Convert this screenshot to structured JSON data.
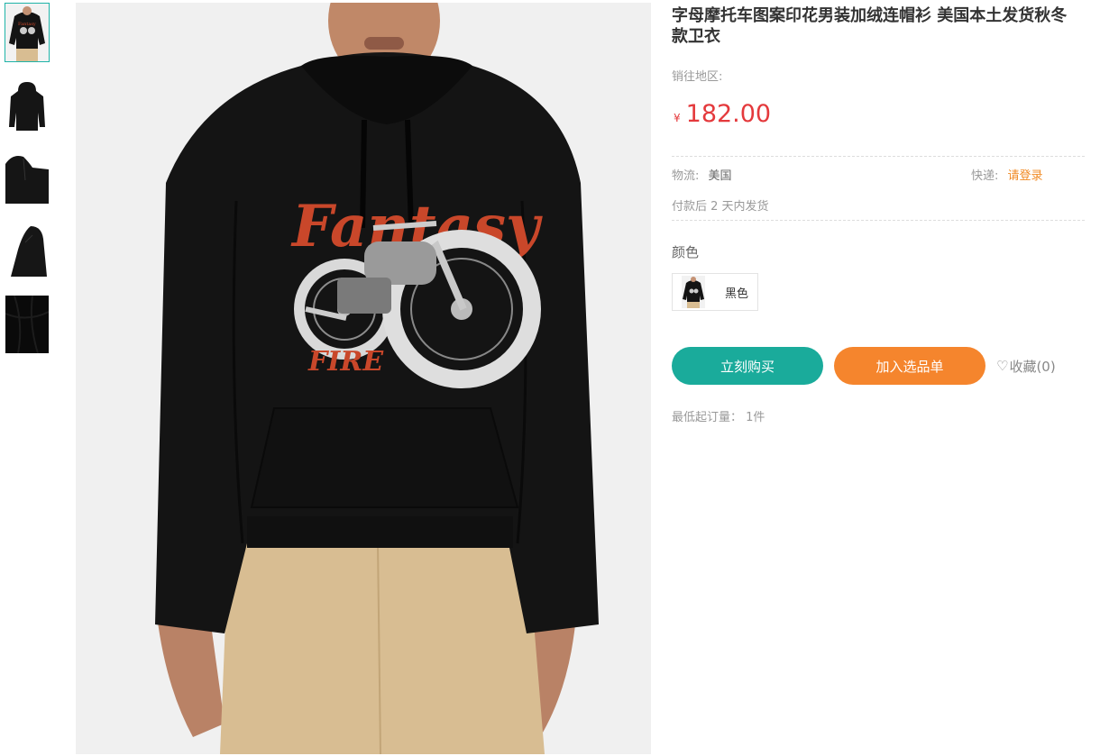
{
  "product": {
    "title": "字母摩托车图案印花男装加绒连帽衫 美国本土发货秋冬款卫衣",
    "region_label": "销往地区:",
    "currency": "¥",
    "price": "182.00",
    "shipping_label": "物流:",
    "shipping_value": "美国",
    "express_label": "快递:",
    "express_link": "请登录",
    "delivery_note": "付款后 2 天内发货",
    "color_label": "颜色",
    "color_option": "黑色",
    "buy_button": "立刻购买",
    "cart_button": "加入选品单",
    "favorite": "收藏(0)",
    "min_order": "最低起订量： 1件"
  },
  "main_image": {
    "print_text_top": "Fantasy",
    "print_text_bottom": "FIRE"
  },
  "colors": {
    "accent_teal": "#1aab9b",
    "accent_orange": "#f5852d",
    "price_red": "#e4393c",
    "hoodie": "#141414",
    "print_orange": "#c9472a",
    "pants_khaki": "#d8bd92"
  },
  "thumbnails": [
    "hoodie-front",
    "hoodie-back",
    "hoodie-side",
    "hoodie-side-model",
    "fabric-closeup"
  ]
}
